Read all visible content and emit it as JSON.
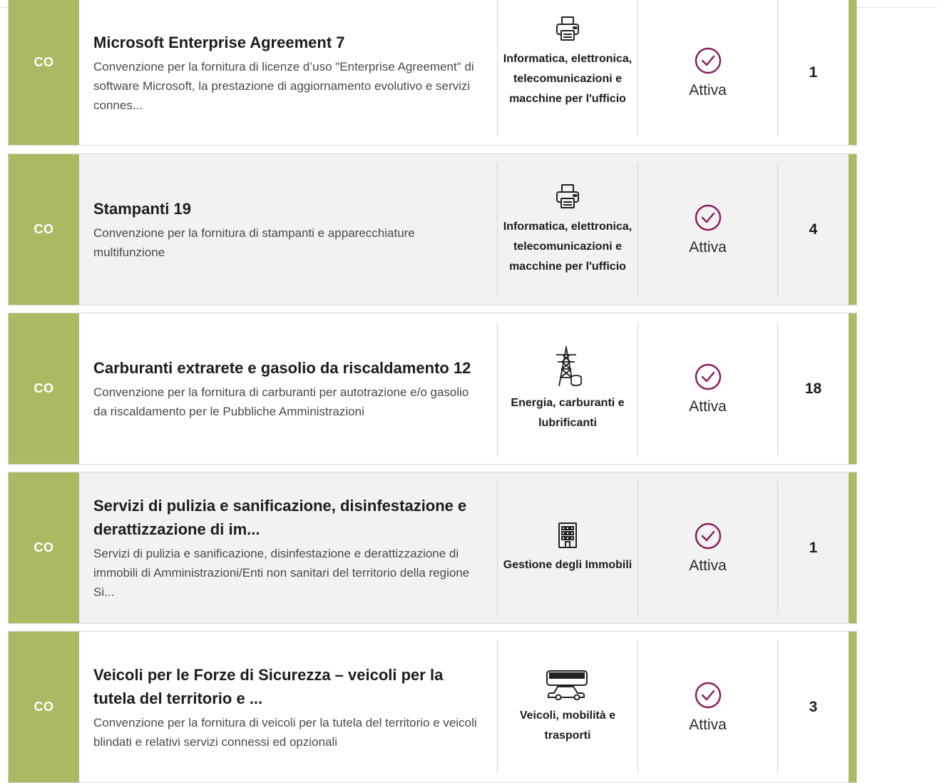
{
  "colors": {
    "accent": "#a9ba62",
    "status_icon": "#8a1a5a"
  },
  "rows": [
    {
      "type": "CO",
      "title": "Microsoft Enterprise Agreement 7",
      "description": "Convenzione per la fornitura di licenze d’uso \"Enterprise Agreement\" di software Microsoft, la prestazione di aggiornamento evolutivo e servizi connes...",
      "category": "Informatica, elettronica, telecomunicazioni e macchine per l'ufficio",
      "category_icon": "printer-icon",
      "status": "Attiva",
      "count": "1"
    },
    {
      "type": "CO",
      "title": "Stampanti 19",
      "description": "Convenzione per la fornitura di stampanti e apparecchiature multifunzione",
      "category": "Informatica, elettronica, telecomunicazioni e macchine per l'ufficio",
      "category_icon": "printer-icon",
      "status": "Attiva",
      "count": "4"
    },
    {
      "type": "CO",
      "title": "Carburanti extrarete e gasolio da riscaldamento 12",
      "description": "Convenzione per la fornitura di carburanti per autotrazione e/o gasolio da riscaldamento per le Pubbliche Amministrazioni",
      "category": "Energia, carburanti e lubrificanti",
      "category_icon": "power-tower-icon",
      "status": "Attiva",
      "count": "18"
    },
    {
      "type": "CO",
      "title": "Servizi di pulizia e sanificazione, disinfestazione e derattizzazione di im...",
      "description": "Servizi di pulizia e sanificazione, disinfestazione e derattizzazione di immobili di Amministrazioni/Enti non sanitari del territorio della regione Si...",
      "category": "Gestione degli Immobili",
      "category_icon": "building-icon",
      "status": "Attiva",
      "count": "1"
    },
    {
      "type": "CO",
      "title": "Veicoli per le Forze di Sicurezza – veicoli per la tutela del territorio e ...",
      "description": "Convenzione per la fornitura di veicoli per la tutela del territorio e veicoli blindati e relativi servizi connessi ed opzionali",
      "category": "Veicoli, mobilità e trasporti",
      "category_icon": "vehicles-icon",
      "status": "Attiva",
      "count": "3"
    }
  ]
}
